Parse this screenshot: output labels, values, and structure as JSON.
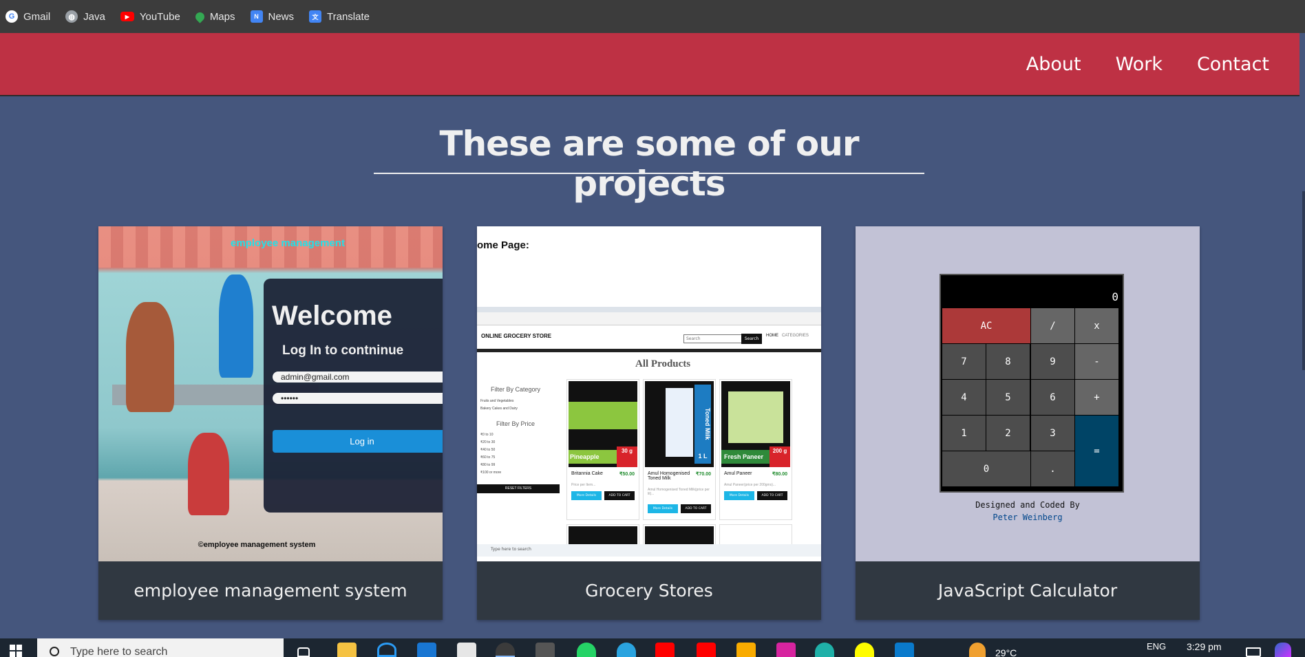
{
  "bookmarks": [
    {
      "label": "Gmail",
      "icon": "google-icon",
      "color": "#4285f4"
    },
    {
      "label": "Java",
      "icon": "globe-icon",
      "color": "#9aa0a6"
    },
    {
      "label": "YouTube",
      "icon": "youtube-icon",
      "color": "#ff0000"
    },
    {
      "label": "Maps",
      "icon": "maps-pin-icon",
      "color": "#34a853"
    },
    {
      "label": "News",
      "icon": "news-icon",
      "color": "#4285f4"
    },
    {
      "label": "Translate",
      "icon": "translate-icon",
      "color": "#4285f4"
    }
  ],
  "nav": {
    "items": [
      "About",
      "Work",
      "Contact"
    ],
    "background": "#be3144"
  },
  "page": {
    "heading": "These are some of our projects",
    "background": "#45567d"
  },
  "projects": [
    {
      "caption": "employee management system",
      "screenshot": {
        "title": "employee management",
        "welcome": "Welcome",
        "subtitle": "Log In to contninue",
        "email": "admin@gmail.com",
        "password": "••••••",
        "button": "Log in",
        "footer": "©employee management system"
      }
    },
    {
      "caption": "Grocery Stores",
      "screenshot": {
        "page_label": "ome Page:",
        "store_name": "ONLINE GROCERY STORE",
        "search_placeholder": "Search",
        "search_button": "Search",
        "nav_home": "HOME",
        "nav_categories": "CATEGORIES",
        "all_products": "All Products",
        "filter_category": "Filter By Category",
        "category_items": [
          "Fruits and Vegetables",
          "Bakery Cakes and Dairy"
        ],
        "filter_price": "Filter By Price",
        "price_items": [
          "₹0 to 10",
          "₹20 to 30",
          "₹40 to 50",
          "₹60 to 75",
          "₹80 to 99",
          "₹100 or more"
        ],
        "reset": "RESET FILTERS",
        "more_details": "More Details",
        "add_to_cart": "ADD TO CART",
        "products": [
          {
            "name": "Britannia Cake",
            "price": "₹50.00",
            "label": "Pineapple Plunge",
            "qty": "30 g",
            "desc": "Price per Item..."
          },
          {
            "name": "Amul Homogenised Toned Milk",
            "price": "₹70.00",
            "label": "Toned Milk",
            "qty": "1 L",
            "desc": "Amul Homogenised Toned Milk(price per lit)..."
          },
          {
            "name": "Amul Paneer",
            "price": "₹80.00",
            "label": "Fresh Paneer",
            "qty": "200 g",
            "desc": "Amul Paneer(price per 200gms)..."
          }
        ],
        "taskbar_search": "Type here to search"
      }
    },
    {
      "caption": "JavaScript Calculator",
      "screenshot": {
        "display": "0",
        "keys": [
          "AC",
          "/",
          "x",
          "7",
          "8",
          "9",
          "-",
          "4",
          "5",
          "6",
          "+",
          "1",
          "2",
          "3",
          "=",
          "0",
          "."
        ],
        "credit": "Designed and Coded By",
        "author": "Peter Weinberg"
      }
    }
  ],
  "taskbar": {
    "search_placeholder": "Type here to search",
    "weather": "29°C",
    "language": "ENG",
    "time": "3:29 pm"
  }
}
